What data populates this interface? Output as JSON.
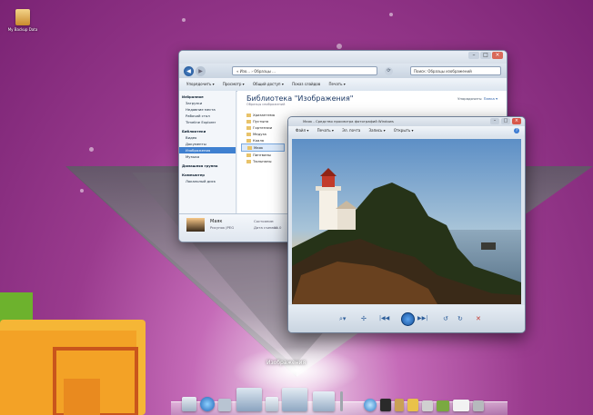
{
  "desktop": {
    "icon_label": "My Backup Data"
  },
  "explorer": {
    "nav_back": "◀",
    "nav_forward": "▶",
    "address": "« Изо... › Образцы ...",
    "search_placeholder": "Поиск: Образцы изображений",
    "toolbar": [
      "Упорядочить ▾",
      "Просмотр ▾",
      "Общий доступ ▾",
      "Показ слайдов",
      "Печать ▾"
    ],
    "nav_groups": [
      {
        "label": "Избранное",
        "items": [
          "Загрузки",
          "Недавние места",
          "Рабочий стол",
          "Timeline Explorer"
        ]
      },
      {
        "label": "Библиотеки",
        "items": [
          "Видео",
          "Документы",
          "Изображения",
          "Музыка"
        ]
      },
      {
        "label": "Домашняя группа",
        "items": []
      },
      {
        "label": "Компьютер",
        "items": [
          "Локальный диск"
        ]
      }
    ],
    "selected_nav": "Изображения",
    "library_title": "Библиотека \"Изображения\"",
    "library_subtitle": "Образцы изображений",
    "arrange_label": "Упорядочить:",
    "arrange_value": "Папка ▾",
    "folders": [
      "Хризантема",
      "Пустыня",
      "Гортензии",
      "Медуза",
      "Коала",
      "Маяк",
      "Пингвины",
      "Тюльпаны"
    ],
    "selected_folder": "Маяк",
    "details": {
      "name": "Маяк",
      "type": "Рисунок JPEG",
      "state_label": "Состояние:",
      "date_label": "Дата съемки:",
      "date_value": "11.0"
    }
  },
  "viewer": {
    "title": "Маяк - Средство просмотра фотографий Windows",
    "menu": [
      "Файл ▾",
      "Печать ▾",
      "Эл. почта",
      "Запись ▾",
      "Открыть ▾"
    ],
    "help": "?",
    "controls": [
      "⌕▾",
      "✢",
      "|◀◀",
      "▶▶|",
      "↺",
      "↻",
      "✕"
    ]
  },
  "stack": {
    "label": "Изображения"
  },
  "colors": {
    "wallpaper": "#9a3b8e",
    "selection": "#3f80d0",
    "folder": "#e8c36a"
  }
}
